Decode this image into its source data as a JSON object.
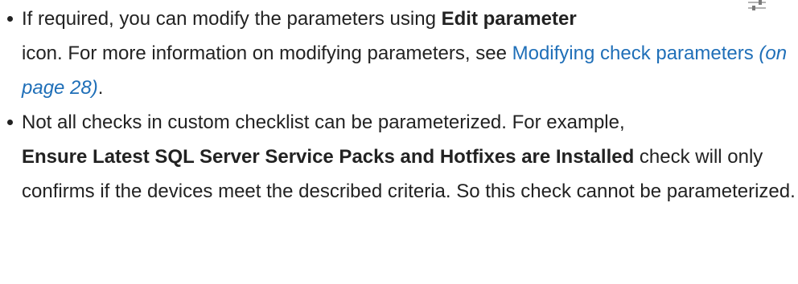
{
  "bullets": [
    {
      "before_bold": "If required, you can modify the parameters using ",
      "bold": "Edit parameter",
      "after_bold": "icon. For more information on modifying parameters, see ",
      "link_text": "Modifying check parameters",
      "link_page_ref": "(on page 28)",
      "end": ".",
      "icon": "edit-parameter-icon"
    },
    {
      "before_bold": "Not all checks in custom checklist can be parameterized. For example, ",
      "bold": "Ensure Latest SQL Server Service Packs and Hotfixes are Installed",
      "after_bold": " check will only confirms if the devices meet the described criteria. So this check cannot be parameterized."
    }
  ],
  "colors": {
    "text": "#222222",
    "link": "#1f6fb8",
    "icon": "#8a8a8a"
  }
}
